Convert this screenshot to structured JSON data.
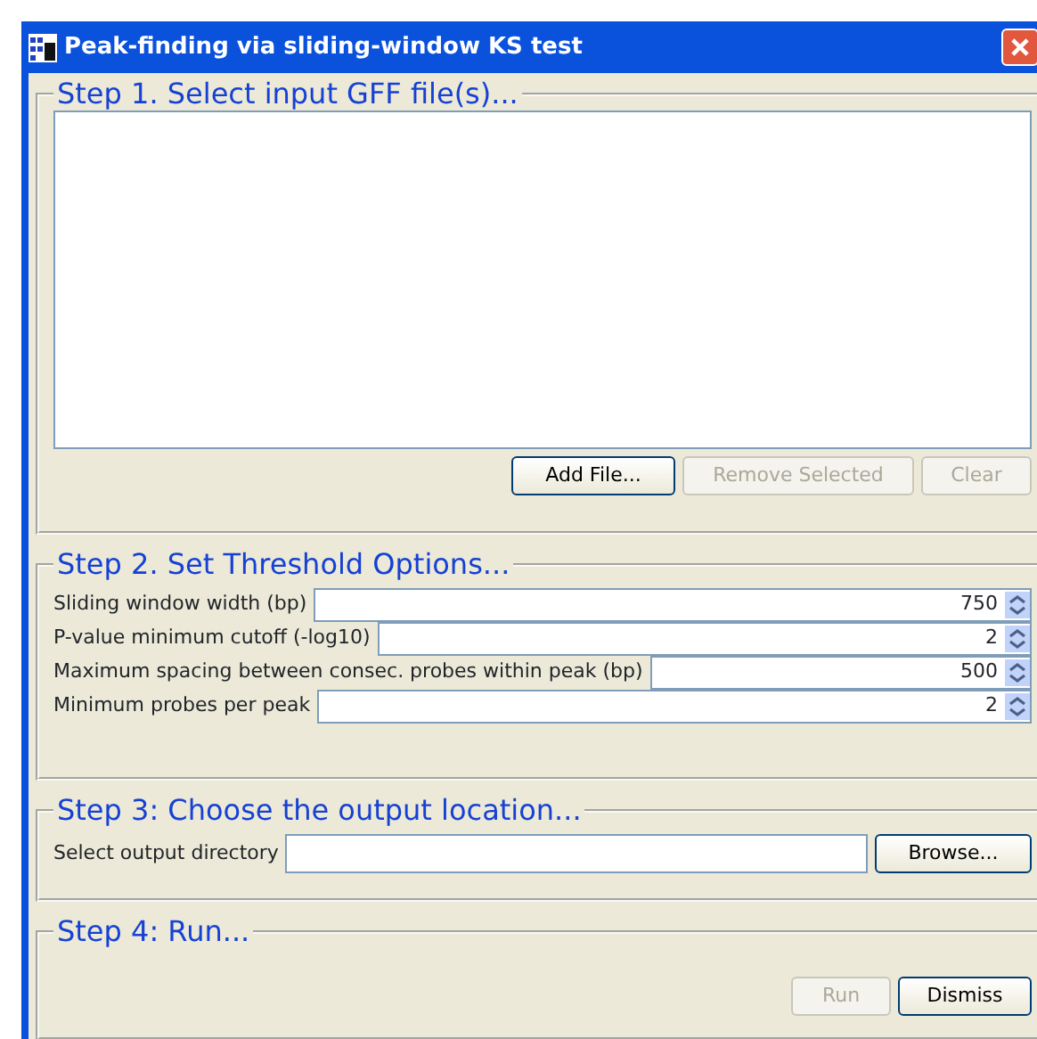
{
  "window": {
    "title": "Peak-finding via sliding-window KS test"
  },
  "steps": [
    {
      "kind": "file-list",
      "title": "Step 1. Select input GFF file(s)...",
      "buttons": [
        {
          "label": "Add File...",
          "disabled": false
        },
        {
          "label": "Remove Selected",
          "disabled": true
        },
        {
          "label": "Clear",
          "disabled": true
        }
      ]
    },
    {
      "kind": "options",
      "title": "Step 2. Set Threshold Options...",
      "fields": [
        {
          "label": "Sliding window width (bp)",
          "value": "750"
        },
        {
          "label": "P-value minimum cutoff (-log10)",
          "value": "2"
        },
        {
          "label": "Maximum spacing between consec. probes within peak (bp)",
          "value": "500"
        },
        {
          "label": "Minimum probes per peak",
          "value": "2"
        }
      ]
    },
    {
      "kind": "output",
      "title": "Step 3: Choose the output location...",
      "label": "Select output directory",
      "buttons": [
        {
          "label": "Browse...",
          "disabled": false
        }
      ]
    },
    {
      "kind": "run",
      "title": "Step 4: Run...",
      "buttons": [
        {
          "label": "Run",
          "disabled": true
        },
        {
          "label": "Dismiss",
          "disabled": false
        }
      ]
    }
  ]
}
